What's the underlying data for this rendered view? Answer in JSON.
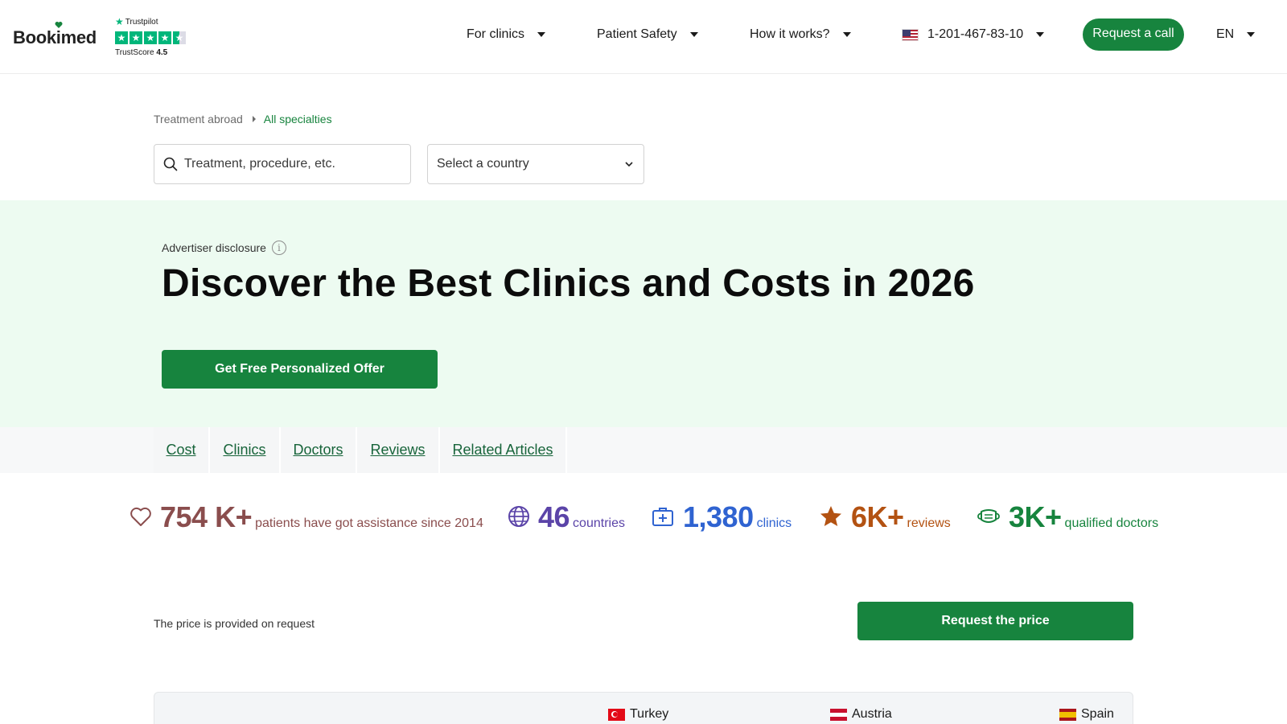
{
  "header": {
    "logo": "Bookimed",
    "trustpilot": {
      "brand": "Trustpilot",
      "score_label": "TrustScore",
      "score": "4.5",
      "stars": 4.5
    },
    "nav": [
      {
        "label": "For clinics"
      },
      {
        "label": "Patient Safety"
      },
      {
        "label": "How it works?"
      }
    ],
    "phone": "1-201-467-83-10",
    "call_button": "Request a call",
    "language": "EN"
  },
  "breadcrumb": {
    "parent": "Treatment abroad",
    "current": "All specialties"
  },
  "search": {
    "placeholder": "Treatment, procedure, etc.",
    "value": ""
  },
  "country_select": {
    "value": "Select a country"
  },
  "hero": {
    "disclosure": "Advertiser disclosure",
    "title": "Discover the Best Clinics and Costs in 2026",
    "offer_button": "Get Free Personalized Offer"
  },
  "tabs": [
    "Cost",
    "Clinics",
    "Doctors",
    "Reviews",
    "Related Articles"
  ],
  "stats": [
    {
      "value": "754 K+",
      "label": "patients have got assistance since 2014",
      "color": "#8a4d4d",
      "icon": "heart-icon"
    },
    {
      "value": "46",
      "label": "countries",
      "color": "#5b44a8",
      "icon": "globe-icon"
    },
    {
      "value": "1,380",
      "label": "clinics",
      "color": "#2f63d1",
      "icon": "medical-case-icon"
    },
    {
      "value": "6K+",
      "label": "reviews",
      "color": "#b35212",
      "icon": "star-icon"
    },
    {
      "value": "3K+",
      "label": "qualified doctors",
      "color": "#17843e",
      "icon": "mask-icon"
    }
  ],
  "price": {
    "note": "The price is provided on request",
    "button": "Request the price"
  },
  "table": {
    "countries": [
      "Turkey",
      "Austria",
      "Spain"
    ]
  },
  "colors": {
    "primary": "#17843e",
    "hero_bg": "#edfbf1",
    "trustpilot": "#00b67a"
  }
}
